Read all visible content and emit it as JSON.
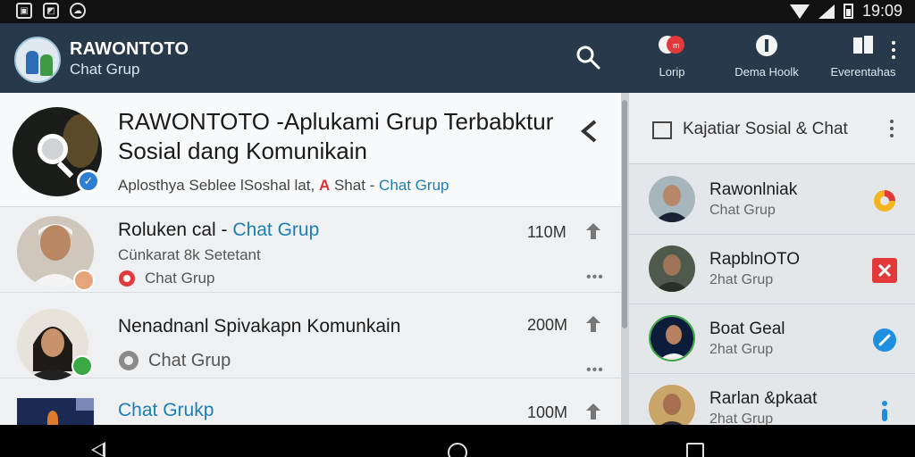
{
  "status_bar": {
    "time": "19:09",
    "left_icons": [
      "screenshot-icon",
      "gallery-icon",
      "cloud-icon"
    ]
  },
  "app_bar": {
    "title": "RAWONTOTO",
    "subtitle": "Chat Grup",
    "actions": [
      {
        "label": "Lorip",
        "icon": "chat-bubble-icon"
      },
      {
        "label": "Dema Hoolk",
        "icon": "info-icon"
      },
      {
        "label": "Everentahas",
        "icon": "book-icon"
      }
    ]
  },
  "featured": {
    "title": "RAWONTOTO -Aplukami Grup Terbabktur Sosial dang Komunikain",
    "meta_prefix": "Aplosthya Seblee lSoshal lat,",
    "meta_warn": "A",
    "meta_middle": "Shat -",
    "meta_link": "Chat Grup"
  },
  "rows": [
    {
      "title": "Roluken cal -",
      "title_link": "Chat Grup",
      "subtitle": "Cünkarat 8k Setetant",
      "tag": "Chat Grup",
      "size": "110M"
    },
    {
      "title": "Nenadnanl Spivakapn Komunkain",
      "tag": "Chat Grup",
      "size": "200M"
    },
    {
      "title_link": "Chat Grukp",
      "size": "100M"
    }
  ],
  "side_panel": {
    "title": "Kajatiar Sosial & Chat",
    "items": [
      {
        "name": "Rawonlniak",
        "sub": "Chat Grup"
      },
      {
        "name": "RapblnOTO",
        "sub": "2hat Grup"
      },
      {
        "name": "Boat Geal",
        "sub": "2hat Grup"
      },
      {
        "name": "Rarlan &pkaat",
        "sub": "2hat Grup"
      }
    ]
  },
  "colors": {
    "app_bar": "#28394b",
    "link": "#1c7fb3",
    "verified": "#2c7fd3"
  }
}
